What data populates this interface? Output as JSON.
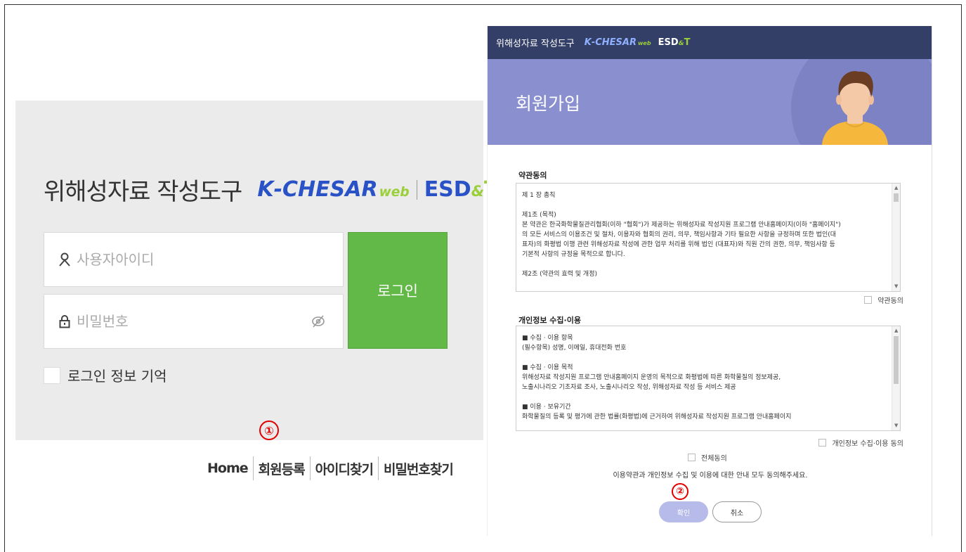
{
  "login": {
    "title": "위해성자료 작성도구",
    "logo": {
      "k": "K",
      "chesar": "-CHESAR",
      "web": "web",
      "esd": "ESD",
      "amp": "&",
      "t": "T"
    },
    "user_id_placeholder": "사용자아이디",
    "password_placeholder": "비밀번호",
    "login_button": "로그인",
    "remember_label": "로그인 정보 기억",
    "links": [
      "Home",
      "회원등록",
      "아이디찾기",
      "비밀번호찾기"
    ],
    "marker": "①"
  },
  "signup": {
    "topbar_title": "위해성자료 작성도구",
    "logo": {
      "k": "K",
      "chesar": "-CHESAR",
      "web": "web",
      "esd": "ESD",
      "amp": "&",
      "t": "T"
    },
    "banner_title": "회원가입",
    "terms_title": "약관동의",
    "terms_lines": [
      "제 1 장 총칙",
      "",
      "제1조 (목적)",
      "본 약관은 한국화학물질관리협회(이하 \"협회\")가 제공하는 위해성자료 작성지원 프로그램 안내홈페이지(이하 \"홈페이지\")",
      "의 모든 서비스의 이용조건 및 절차, 이용자와 협회의 권리, 의무, 책임사항과 기타 필요한 사항을 규정하며 또한 법인(대",
      "표자)의 화평법 이행 관련 위해성자료 작성에 관한 업무 처리를 위해 법인 (대표자)와 직원 간의 권한, 의무, 책임사항 등",
      "기본적 사항의 규정을 목적으로 합니다.",
      "",
      "제2조 (약관의 효력 및 개정)"
    ],
    "terms_agree": "약관동의",
    "privacy_title": "개인정보 수집·이용",
    "privacy_lines": [
      "■ 수집 · 이용 항목",
      "(필수항목) 성명, 이메일, 휴대전화 번호",
      "",
      "■ 수집 · 이용 목적",
      "위해성자료 작성지원 프로그램 안내홈페이지 운영의 목적으로 화평법에 따른 화학물질의 정보제공,",
      "노출시나리오 기초자료 조사, 노출시나리오 작성, 위해성자료 작성 등 서비스 제공",
      "",
      "■ 이용 · 보유기간",
      "화학물질의 등록 및 평가에 관한 법률(화평법)에 근거하여 위해성자료 작성지원 프로그램 안내홈페이지"
    ],
    "privacy_agree": "개인정보 수집·이용 동의",
    "agree_all": "전체동의",
    "notice": "이용약관과 개인정보 수집 및 이용에 대한 안내 모두 동의해주세요.",
    "marker": "②",
    "confirm_button": "확인",
    "cancel_button": "취소"
  },
  "colors": {
    "login_green": "#62b948",
    "topbar_navy": "#333f66",
    "banner_purple": "#8a90cf",
    "marker_red": "#e00000",
    "brand_blue": "#2a52c7",
    "brand_green": "#9bcf3a"
  },
  "icons": [
    "user-icon",
    "lock-icon",
    "eye-off-icon",
    "avatar"
  ]
}
